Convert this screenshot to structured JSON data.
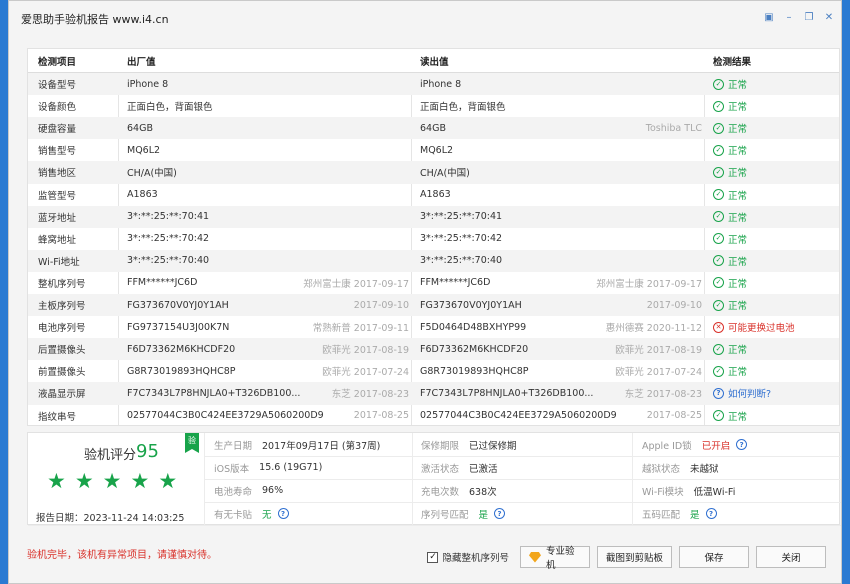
{
  "window": {
    "title": "爱思助手验机报告 www.i4.cn",
    "controls": [
      "skin-icon",
      "minimize-icon",
      "restore-icon",
      "close-icon"
    ]
  },
  "table": {
    "headers": [
      "检测项目",
      "出厂值",
      "读出值",
      "检测结果"
    ],
    "rows": [
      {
        "item": "设备型号",
        "factory": "iPhone 8",
        "factory_sub": "",
        "read": "iPhone 8",
        "read_sub": "",
        "result": "正常",
        "status": "ok"
      },
      {
        "item": "设备颜色",
        "factory": "正面白色，背面银色",
        "factory_sub": "",
        "read": "正面白色，背面银色",
        "read_sub": "",
        "result": "正常",
        "status": "ok"
      },
      {
        "item": "硬盘容量",
        "factory": "64GB",
        "factory_sub": "",
        "read": "64GB",
        "read_sub": "Toshiba TLC",
        "result": "正常",
        "status": "ok"
      },
      {
        "item": "销售型号",
        "factory": "MQ6L2",
        "factory_sub": "",
        "read": "MQ6L2",
        "read_sub": "",
        "result": "正常",
        "status": "ok"
      },
      {
        "item": "销售地区",
        "factory": "CH/A(中国)",
        "factory_sub": "",
        "read": "CH/A(中国)",
        "read_sub": "",
        "result": "正常",
        "status": "ok"
      },
      {
        "item": "监管型号",
        "factory": "A1863",
        "factory_sub": "",
        "read": "A1863",
        "read_sub": "",
        "result": "正常",
        "status": "ok"
      },
      {
        "item": "蓝牙地址",
        "factory": "3*:**:25:**:70:41",
        "factory_sub": "",
        "read": "3*:**:25:**:70:41",
        "read_sub": "",
        "result": "正常",
        "status": "ok"
      },
      {
        "item": "蜂窝地址",
        "factory": "3*:**:25:**:70:42",
        "factory_sub": "",
        "read": "3*:**:25:**:70:42",
        "read_sub": "",
        "result": "正常",
        "status": "ok"
      },
      {
        "item": "Wi-Fi地址",
        "factory": "3*:**:25:**:70:40",
        "factory_sub": "",
        "read": "3*:**:25:**:70:40",
        "read_sub": "",
        "result": "正常",
        "status": "ok"
      },
      {
        "item": "整机序列号",
        "factory": "FFM******JC6D",
        "factory_sub": "郑州富士康 2017-09-17",
        "read": "FFM******JC6D",
        "read_sub": "郑州富士康 2017-09-17",
        "result": "正常",
        "status": "ok"
      },
      {
        "item": "主板序列号",
        "factory": "FG373670V0YJ0Y1AH",
        "factory_sub": "2017-09-10",
        "read": "FG373670V0YJ0Y1AH",
        "read_sub": "2017-09-10",
        "result": "正常",
        "status": "ok"
      },
      {
        "item": "电池序列号",
        "factory": "FG9737154U3J00K7N",
        "factory_sub": "常熟新普 2017-09-11",
        "read": "F5D0464D48BXHYP99",
        "read_sub": "惠州德赛 2020-11-12",
        "result": "可能更换过电池",
        "status": "bad"
      },
      {
        "item": "后置摄像头",
        "factory": "F6D73362M6KHCDF20",
        "factory_sub": "欧菲光 2017-08-19",
        "read": "F6D73362M6KHCDF20",
        "read_sub": "欧菲光 2017-08-19",
        "result": "正常",
        "status": "ok"
      },
      {
        "item": "前置摄像头",
        "factory": "G8R73019893HQHC8P",
        "factory_sub": "欧菲光 2017-07-24",
        "read": "G8R73019893HQHC8P",
        "read_sub": "欧菲光 2017-07-24",
        "result": "正常",
        "status": "ok"
      },
      {
        "item": "液晶显示屏",
        "factory": "F7C7343L7P8HNJLA0+T326DB100...",
        "factory_sub": "东芝 2017-08-23",
        "read": "F7C7343L7P8HNJLA0+T326DB100...",
        "read_sub": "东芝 2017-08-23",
        "result": "如何判断?",
        "status": "question"
      },
      {
        "item": "指纹串号",
        "factory": "02577044C3B0C424EE3729A5060200D9",
        "factory_sub": "2017-08-25",
        "read": "02577044C3B0C424EE3729A5060200D9",
        "read_sub": "2017-08-25",
        "result": "正常",
        "status": "ok"
      }
    ]
  },
  "summary": {
    "score_label": "验机评分",
    "score": "95",
    "stars": 5,
    "badge": "验",
    "report_date": "报告日期：2023-11-24 14:03:25",
    "cells": {
      "prod_date_label": "生产日期",
      "prod_date_value": "2017年09月17日 (第37周)",
      "warranty_label": "保修期限",
      "warranty_value": "已过保修期",
      "appleid_label": "Apple ID锁",
      "appleid_value": "已开启",
      "ios_label": "iOS版本",
      "ios_value": "15.6 (19G71)",
      "activation_label": "激活状态",
      "activation_value": "已激活",
      "jailbreak_label": "越狱状态",
      "jailbreak_value": "未越狱",
      "battery_label": "电池寿命",
      "battery_value": "96%",
      "charge_label": "充电次数",
      "charge_value": "638次",
      "wifi_label": "Wi-Fi模块",
      "wifi_value": "低温Wi-Fi",
      "nocard_label": "有无卡贴",
      "nocard_value": "无",
      "serialmatch_label": "序列号匹配",
      "serialmatch_value": "是",
      "fivecode_label": "五码匹配",
      "fivecode_value": "是"
    }
  },
  "footer": {
    "message": "验机完毕，该机有异常项目，请谨慎对待。",
    "hide_serial_label": "隐藏整机序列号",
    "hide_serial_checked": true,
    "pro_button": "专业验机",
    "clipboard_button": "截图到剪贴板",
    "save_button": "保存",
    "close_button": "关闭"
  },
  "colors": {
    "ok": "#18a34a",
    "bad": "#d9312a",
    "link": "#2f6fd0",
    "accent": "#f2a61b"
  }
}
